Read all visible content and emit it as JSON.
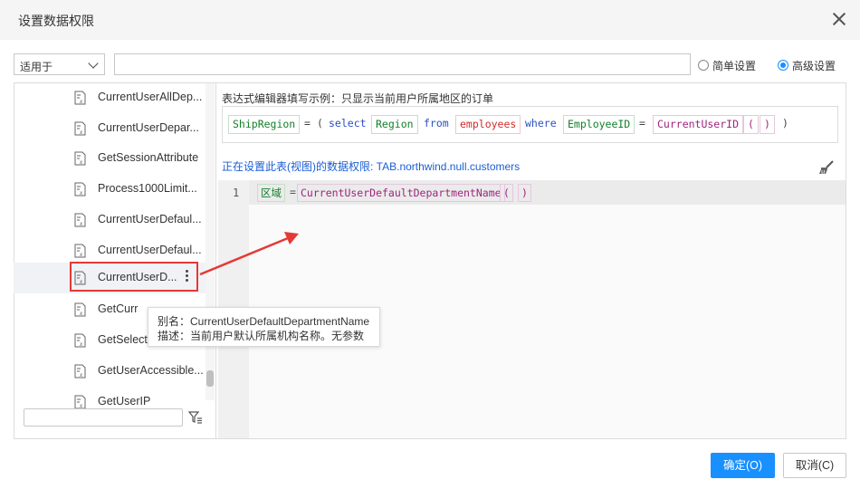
{
  "dialog": {
    "title": "设置数据权限"
  },
  "scope": {
    "select_value": "适用于",
    "input_value": ""
  },
  "modes": {
    "simple": "简单设置",
    "advanced": "高级设置",
    "selected": "advanced"
  },
  "functions": [
    "CurrentUserAllDep...",
    "CurrentUserDepar...",
    "GetSessionAttribute",
    "Process1000Limit...",
    "CurrentUserDefaul...",
    "CurrentUserDefaul...",
    "CurrentUserD...",
    "GetCurr",
    "GetSelect",
    "GetUserAccessible...",
    "GetUserIP"
  ],
  "selected_index": 6,
  "function_search": {
    "value": ""
  },
  "tooltip": {
    "alias": "别名：CurrentUserDefaultDepartmentName",
    "desc": "描述：当前用户默认所属机构名称。无参数"
  },
  "example": {
    "hint": "表达式编辑器填写示例：只显示当前用户所属地区的订单",
    "tokens": [
      "ShipRegion",
      "=",
      "(",
      "select",
      "Region",
      "from",
      "employees",
      "where",
      "EmployeeID",
      "=",
      "CurrentUserID",
      "(",
      ")",
      ")"
    ]
  },
  "status": "正在设置此表(视图)的数据权限: TAB.northwind.null.customers",
  "editor": {
    "line_number": "1",
    "tokens": [
      "区域",
      "=",
      "CurrentUserDefaultDepartmentName",
      "(",
      ")"
    ]
  },
  "buttons": {
    "ok": "确定(O)",
    "cancel": "取消(C)"
  },
  "colors": {
    "accent": "#1890ff",
    "highlight": "#e53935",
    "link_text": "#1b5ed6"
  }
}
